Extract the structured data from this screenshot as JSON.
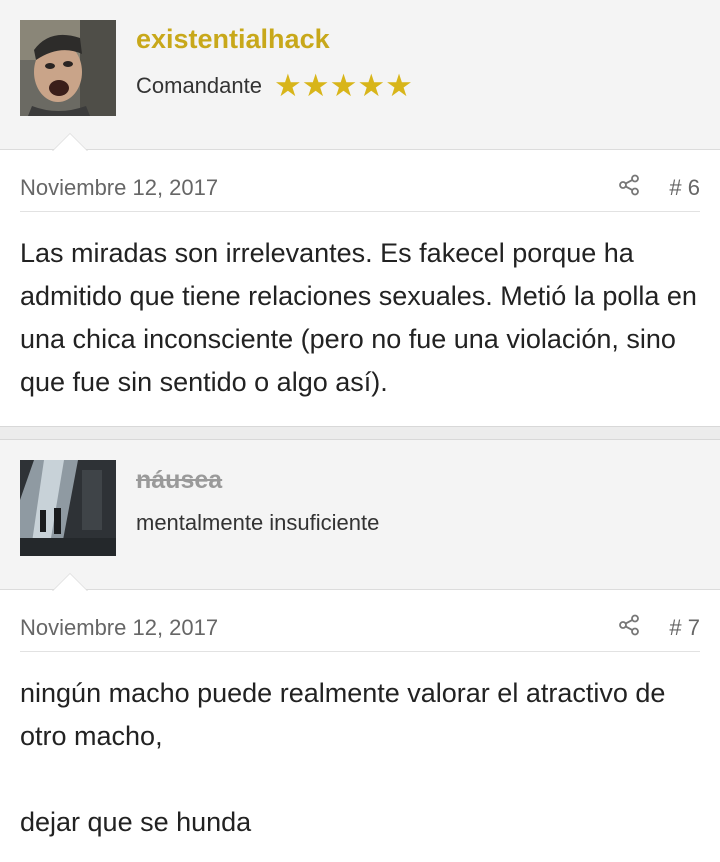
{
  "posts": [
    {
      "username": "existentialhack",
      "user_title": "Comandante",
      "stars": "★★★★★",
      "date": "Noviembre 12, 2017",
      "number": "# 6",
      "body": "Las miradas son irrelevantes. Es fakecel porque ha admitido que tiene relaciones sexuales. Metió la polla en una chica inconsciente (pero no fue una violación, sino que fue sin sentido o algo así)."
    },
    {
      "username": "náusea",
      "user_title": "mentalmente insuficiente",
      "date": "Noviembre 12, 2017",
      "number": "# 7",
      "body_line1": "ningún macho puede realmente valorar el atractivo de otro macho,",
      "body_line2": "dejar que se hunda"
    }
  ],
  "colors": {
    "username_gold": "#c8a81a",
    "star_gold": "#d8b51a",
    "banned_gray": "#9a9a9a"
  },
  "icons": {
    "share": "share-icon"
  }
}
